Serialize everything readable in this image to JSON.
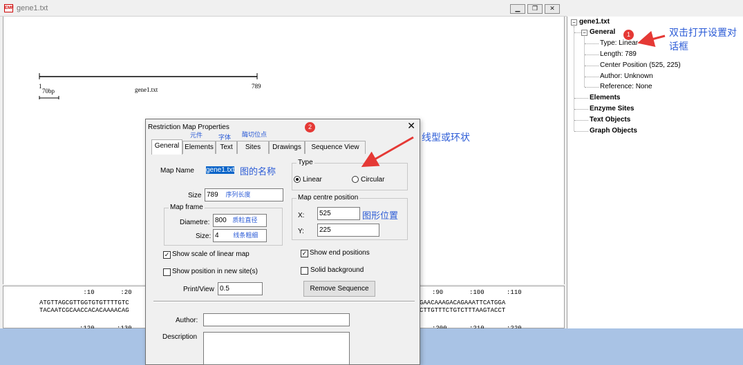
{
  "window": {
    "title": "gene1.txt",
    "icon": "app-map-icon",
    "controls": [
      "minimize",
      "restore",
      "close"
    ]
  },
  "canvas": {
    "scale_start": "1",
    "scale_end": "789",
    "scale_unit": "70bp",
    "map_name": "gene1.txt"
  },
  "sequence": {
    "ruler_top": " :10       :20",
    "ruler_top_right": ":90       :100      :110",
    "seq1_left": "ATGTTAGCGTTGGTGTGTTTTGTC",
    "seq2_left": "TACAATCGCAACCACACAAAACAG",
    "seq1_right": "GAACAAAGACAGAAATTCATGGA",
    "seq2_right": "CTTGTTTCTGTCTTTAAGTACCT",
    "ruler_bottom": ":120      :130",
    "ruler_bottom_right": ":200      :210      :220"
  },
  "tree": {
    "root": "gene1.txt",
    "general": "General",
    "type": "Type: Linear",
    "length": "Length: 789",
    "center": "Center Position (525, 225)",
    "author": "Author: Unknown",
    "reference": "Reference: None",
    "elements": "Elements",
    "enzyme_sites": "Enzyme Sites",
    "text_objects": "Text Objects",
    "graph_objects": "Graph Objects"
  },
  "annotations": {
    "badge1": "1",
    "badge2": "2",
    "tree_note_line1": "双击打开设置对",
    "tree_note_line2": "话框",
    "linear_or_circular": "线型或环状",
    "tab_elements_note": "元件",
    "tab_text_note": "字体",
    "tab_sites_note": "酶切位点",
    "map_name_note": "图的名称",
    "size_note": "序列长度",
    "diameter_note": "质粒直径",
    "line_size_note": "线条粗细",
    "position_note": "图形位置"
  },
  "dialog": {
    "title": "Restriction Map Properties",
    "close": "✕",
    "tabs": [
      "General",
      "Elements",
      "Text",
      "Sites",
      "Drawings",
      "Sequence View"
    ],
    "map_name_label": "Map Name",
    "map_name_value": "gene1.txt",
    "size_label": "Size",
    "size_value": "789",
    "map_frame_title": "Map frame",
    "diameter_label": "Diametre:",
    "diameter_value": "800",
    "frame_size_label": "Size:",
    "frame_size_value": "4",
    "type_title": "Type",
    "linear_label": "Linear",
    "circular_label": "Circular",
    "type_selected": "Linear",
    "centre_title": "Map centre position",
    "x_label": "X:",
    "x_value": "525",
    "y_label": "Y:",
    "y_value": "225",
    "show_scale_label": "Show scale of linear map",
    "show_scale_checked": true,
    "show_position_label": "Show position in new site(s)",
    "show_position_checked": false,
    "show_end_label": "Show end positions",
    "show_end_checked": true,
    "solid_bg_label": "Solid background",
    "solid_bg_checked": false,
    "print_view_label": "Print/View",
    "print_view_value": "0.5",
    "remove_sequence_label": "Remove Sequence",
    "author_label": "Author:",
    "author_value": "",
    "description_label": "Description",
    "description_value": ""
  },
  "colors": {
    "annotation_blue": "#2b5bd6",
    "badge_red": "#e53935",
    "arrow_red": "#e53935",
    "selection_blue": "#0a64c8",
    "taskbar": "#a9c3e5"
  }
}
